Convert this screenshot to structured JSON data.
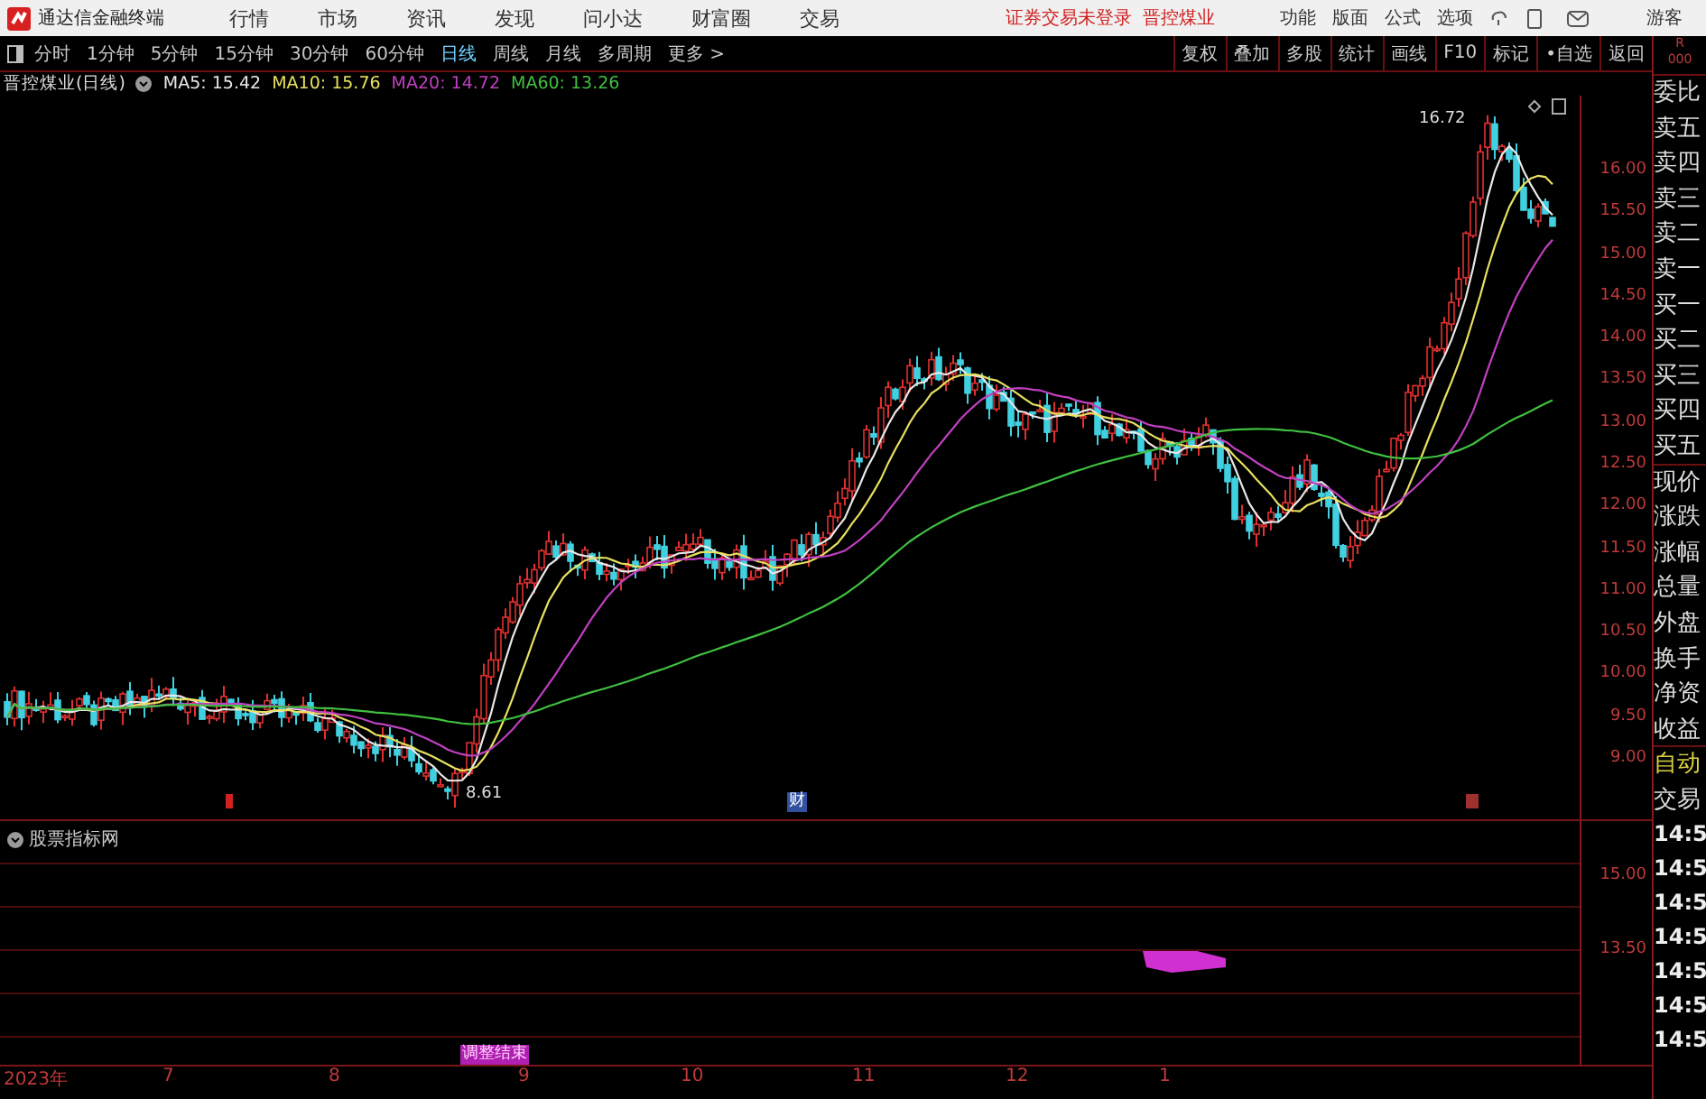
{
  "title_bar": {
    "app_name": "通达信金融终端",
    "menu": [
      "行情",
      "市场",
      "资讯",
      "发现",
      "问小达",
      "财富圈",
      "交易"
    ],
    "notices": [
      "证券交易未登录",
      "晋控煤业"
    ],
    "tools": [
      "功能",
      "版面",
      "公式",
      "选项"
    ],
    "user": "游客"
  },
  "toolbar": {
    "periods": [
      {
        "label": "分时",
        "selected": false
      },
      {
        "label": "1分钟",
        "selected": false
      },
      {
        "label": "5分钟",
        "selected": false
      },
      {
        "label": "15分钟",
        "selected": false
      },
      {
        "label": "30分钟",
        "selected": false
      },
      {
        "label": "60分钟",
        "selected": false
      },
      {
        "label": "日线",
        "selected": true
      },
      {
        "label": "周线",
        "selected": false
      },
      {
        "label": "月线",
        "selected": false
      },
      {
        "label": "多周期",
        "selected": false
      },
      {
        "label": "更多 >",
        "selected": false
      }
    ],
    "buttons": [
      "复权",
      "叠加",
      "多股",
      "统计",
      "画线",
      "F10",
      "标记",
      "•自选",
      "返回"
    ]
  },
  "chart": {
    "title": "晋控煤业(日线)",
    "legend": [
      {
        "label": "MA5: 15.42",
        "color": "#e8e8e8"
      },
      {
        "label": "MA10: 15.76",
        "color": "#e8e060"
      },
      {
        "label": "MA20: 14.72",
        "color": "#c040c0"
      },
      {
        "label": "MA60: 13.26",
        "color": "#40c040"
      }
    ],
    "high_label": "16.72",
    "low_label": "8.61",
    "event_label": "财",
    "y_axis": [
      "16.00",
      "15.50",
      "15.00",
      "14.50",
      "14.00",
      "13.50",
      "13.00",
      "12.50",
      "12.00",
      "11.50",
      "11.00",
      "10.50",
      "10.00",
      "9.50",
      "9.00"
    ]
  },
  "indicator": {
    "title": "股票指标网",
    "signal_label": "调整结束",
    "y_axis": [
      "15.00",
      "13.50"
    ]
  },
  "x_axis": [
    "2023年",
    "7",
    "8",
    "9",
    "10",
    "11",
    "12",
    "1"
  ],
  "quote_panel": {
    "header": [
      "R",
      "000"
    ],
    "items": [
      {
        "label": "委比",
        "kind": "field"
      },
      {
        "label": "卖五",
        "kind": "field"
      },
      {
        "label": "卖四",
        "kind": "field"
      },
      {
        "label": "卖三",
        "kind": "field"
      },
      {
        "label": "卖二",
        "kind": "field"
      },
      {
        "label": "卖一",
        "kind": "field"
      },
      {
        "label": "买一",
        "kind": "field"
      },
      {
        "label": "买二",
        "kind": "field"
      },
      {
        "label": "买三",
        "kind": "field"
      },
      {
        "label": "买四",
        "kind": "field"
      },
      {
        "label": "买五",
        "kind": "field"
      },
      {
        "label": "现价",
        "kind": "field"
      },
      {
        "label": "涨跌",
        "kind": "field"
      },
      {
        "label": "涨幅",
        "kind": "field"
      },
      {
        "label": "总量",
        "kind": "field"
      },
      {
        "label": "外盘",
        "kind": "field"
      },
      {
        "label": "换手",
        "kind": "field"
      },
      {
        "label": "净资",
        "kind": "field"
      },
      {
        "label": "收益",
        "kind": "field"
      },
      {
        "label": "自动",
        "kind": "action"
      },
      {
        "label": "交易",
        "kind": "field"
      }
    ],
    "times": [
      "14:5",
      "14:5",
      "14:5",
      "14:5",
      "14:5",
      "14:5",
      "14:5"
    ]
  }
}
